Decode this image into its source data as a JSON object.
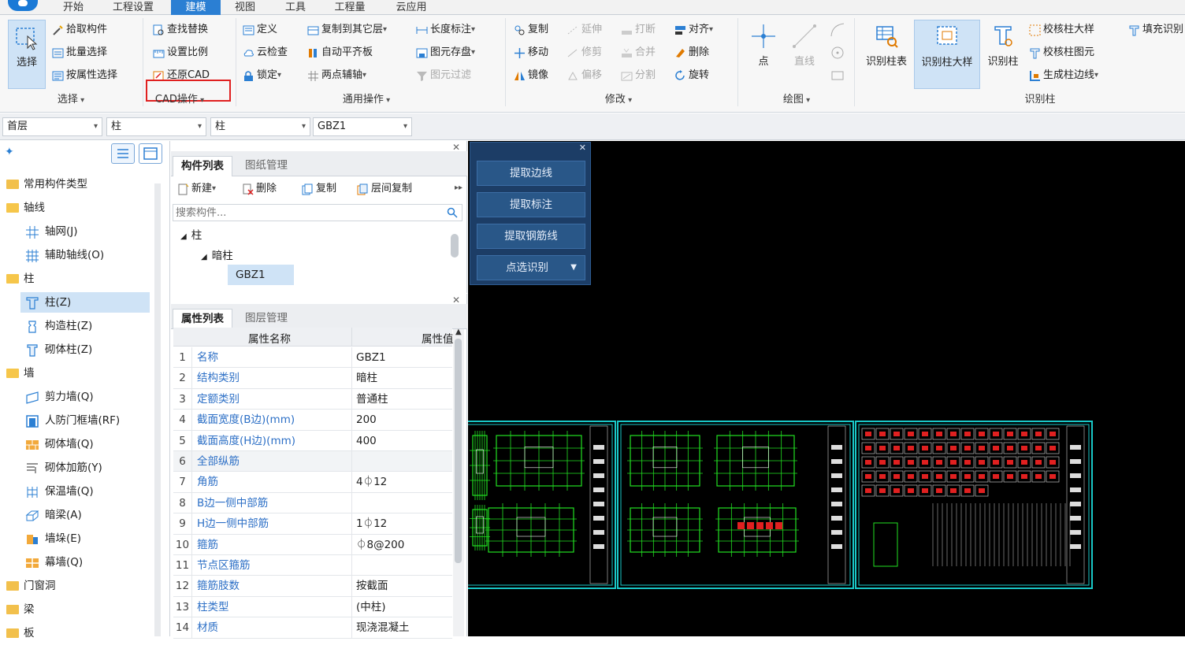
{
  "menu_tabs": [
    "开始",
    "工程设置",
    "建模",
    "视图",
    "工具",
    "工程量",
    "云应用"
  ],
  "active_tab": "建模",
  "ribbon": {
    "select_group": {
      "select_label": "选择",
      "items": [
        "拾取构件",
        "批量选择",
        "按属性选择"
      ],
      "group_label": "选择"
    },
    "cad_group": {
      "items": [
        "查找替换",
        "设置比例",
        "还原CAD"
      ],
      "group_label": "CAD操作"
    },
    "general_group": {
      "col1": [
        "定义",
        "云检查",
        "锁定"
      ],
      "col2": [
        "复制到其它层",
        "自动平齐板",
        "两点辅轴"
      ],
      "col3": [
        "长度标注",
        "图元存盘",
        "图元过滤"
      ],
      "group_label": "通用操作"
    },
    "modify_group": {
      "col1": [
        "复制",
        "移动",
        "镜像"
      ],
      "col2": [
        "延伸",
        "修剪",
        "偏移"
      ],
      "col3": [
        "打断",
        "合并",
        "分割"
      ],
      "col4": [
        "对齐",
        "删除",
        "旋转"
      ],
      "group_label": "修改"
    },
    "draw_group": {
      "point_label": "点",
      "line_label": "直线",
      "group_label": "绘图"
    },
    "recognize_group": {
      "big_buttons": [
        "识别柱表",
        "识别柱大样",
        "识别柱"
      ],
      "col": [
        "校核柱大样",
        "校核柱图元",
        "生成柱边线"
      ],
      "extra": "填充识别",
      "group_label": "识别柱"
    }
  },
  "selectors": {
    "floor": "首层",
    "category": "柱",
    "type": "柱",
    "component": "GBZ1"
  },
  "tree": {
    "groups": [
      {
        "label": "常用构件类型",
        "items": []
      },
      {
        "label": "轴线",
        "items": [
          "轴网(J)",
          "辅助轴线(O)"
        ]
      },
      {
        "label": "柱",
        "items": [
          "柱(Z)",
          "构造柱(Z)",
          "砌体柱(Z)"
        ]
      },
      {
        "label": "墙",
        "items": [
          "剪力墙(Q)",
          "人防门框墙(RF)",
          "砌体墙(Q)",
          "砌体加筋(Y)",
          "保温墙(Q)",
          "暗梁(A)",
          "墙垛(E)",
          "幕墙(Q)"
        ]
      },
      {
        "label": "门窗洞",
        "items": []
      },
      {
        "label": "梁",
        "items": []
      },
      {
        "label": "板",
        "items": []
      }
    ],
    "selected": "柱(Z)"
  },
  "component_panel": {
    "tabs": [
      "构件列表",
      "图纸管理"
    ],
    "toolbar": [
      "新建",
      "删除",
      "复制",
      "层间复制"
    ],
    "search_placeholder": "搜索构件...",
    "tree": [
      "柱",
      "暗柱",
      "GBZ1"
    ]
  },
  "property_panel": {
    "tabs": [
      "属性列表",
      "图层管理"
    ],
    "header_name": "属性名称",
    "header_value": "属性值",
    "rows": [
      {
        "n": "1",
        "k": "名称",
        "v": "GBZ1"
      },
      {
        "n": "2",
        "k": "结构类别",
        "v": "暗柱"
      },
      {
        "n": "3",
        "k": "定额类别",
        "v": "普通柱"
      },
      {
        "n": "4",
        "k": "截面宽度(B边)(mm)",
        "v": "200"
      },
      {
        "n": "5",
        "k": "截面高度(H边)(mm)",
        "v": "400"
      },
      {
        "n": "6",
        "k": "全部纵筋",
        "v": ""
      },
      {
        "n": "7",
        "k": "角筋",
        "v": "4⏀12"
      },
      {
        "n": "8",
        "k": "B边一侧中部筋",
        "v": ""
      },
      {
        "n": "9",
        "k": "H边一侧中部筋",
        "v": "1⏀12"
      },
      {
        "n": "10",
        "k": "箍筋",
        "v": "⏀8@200"
      },
      {
        "n": "11",
        "k": "节点区箍筋",
        "v": ""
      },
      {
        "n": "12",
        "k": "箍筋肢数",
        "v": "按截面"
      },
      {
        "n": "13",
        "k": "柱类型",
        "v": "(中柱)"
      },
      {
        "n": "14",
        "k": "材质",
        "v": "现浇混凝土"
      }
    ]
  },
  "float_panel": {
    "buttons": [
      "提取边线",
      "提取标注",
      "提取钢筋线",
      "点选识别"
    ]
  },
  "colors": {
    "accent": "#2b7fd3",
    "highlight": "#e02020",
    "drawing_frame": "#19c8c8",
    "drawing_lines": "#22e022"
  }
}
